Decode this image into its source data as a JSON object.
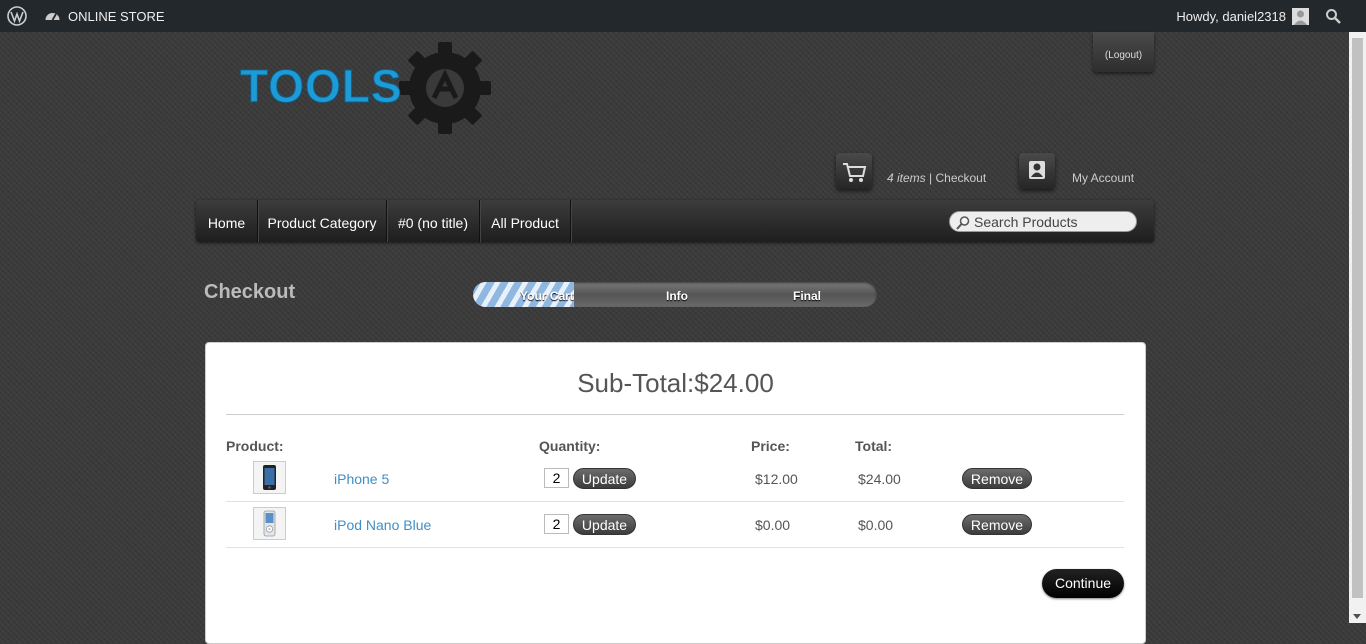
{
  "adminbar": {
    "site_title": "ONLINE STORE",
    "greeting": "Howdy, daniel2318"
  },
  "header": {
    "logo_text": "TOOLS",
    "logout_label": "(Logout)",
    "cart_items": "4 items",
    "cart_separator": " | ",
    "cart_checkout": "Checkout",
    "account_label": "My Account"
  },
  "nav": {
    "items": [
      {
        "label": "Home"
      },
      {
        "label": "Product Category"
      },
      {
        "label": "#0 (no title)"
      },
      {
        "label": "All Product"
      }
    ],
    "search_placeholder": "Search Products"
  },
  "checkout": {
    "title": "Checkout",
    "steps": [
      "Your Cart",
      "Info",
      "Final"
    ],
    "current_step": "Your Cart",
    "progress_fraction": 0.25
  },
  "cart": {
    "subtotal": "Sub-Total:$24.00",
    "headers": {
      "product": "Product:",
      "quantity": "Quantity:",
      "price": "Price:",
      "total": "Total:"
    },
    "update_label": "Update",
    "remove_label": "Remove",
    "items": [
      {
        "name": "iPhone 5",
        "quantity": "2",
        "price": "$12.00",
        "total": "$24.00"
      },
      {
        "name": "iPod Nano Blue",
        "quantity": "2",
        "price": "$0.00",
        "total": "$0.00"
      }
    ],
    "continue_label": "Continue"
  },
  "colors": {
    "background": "#3a3a3a",
    "adminbar": "#23282d",
    "accent_blue": "#1e9bd7",
    "link": "#3f8fc5"
  }
}
